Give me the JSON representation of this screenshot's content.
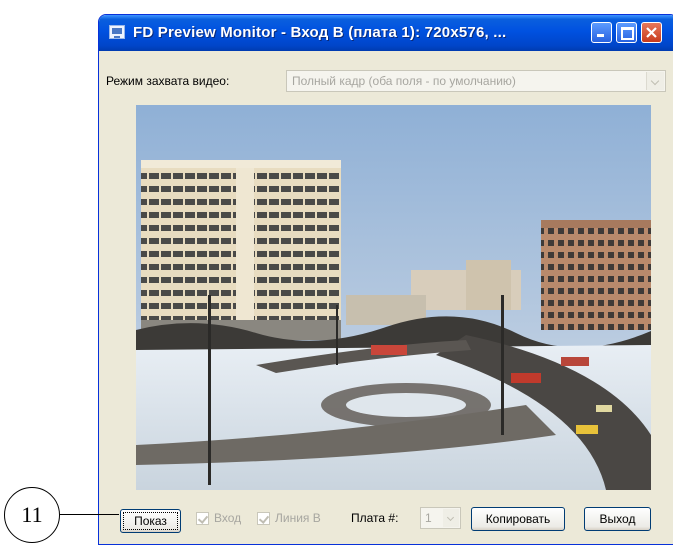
{
  "window": {
    "title": "FD Preview Monitor - Вход В (плата 1): 720x576, ...",
    "controls": [
      "minimize-icon",
      "maximize-icon",
      "close-icon"
    ]
  },
  "capture_mode": {
    "label": "Режим захвата видео:",
    "value": "Полный кадр (оба поля - по умолчанию)"
  },
  "preview": {
    "content": "video-frame"
  },
  "controls": {
    "show_button": "Показ",
    "input_checkbox": {
      "label": "Вход",
      "checked": true
    },
    "line_checkbox": {
      "label": "Линия В",
      "checked": true
    },
    "board_label": "Плата #:",
    "board_value": "1",
    "copy_button": "Копировать",
    "exit_button": "Выход"
  },
  "callout": {
    "number": "11"
  },
  "colors": {
    "titlebar": "#0051e0",
    "window_bg": "#ece9d8",
    "close": "#c83a1c"
  }
}
